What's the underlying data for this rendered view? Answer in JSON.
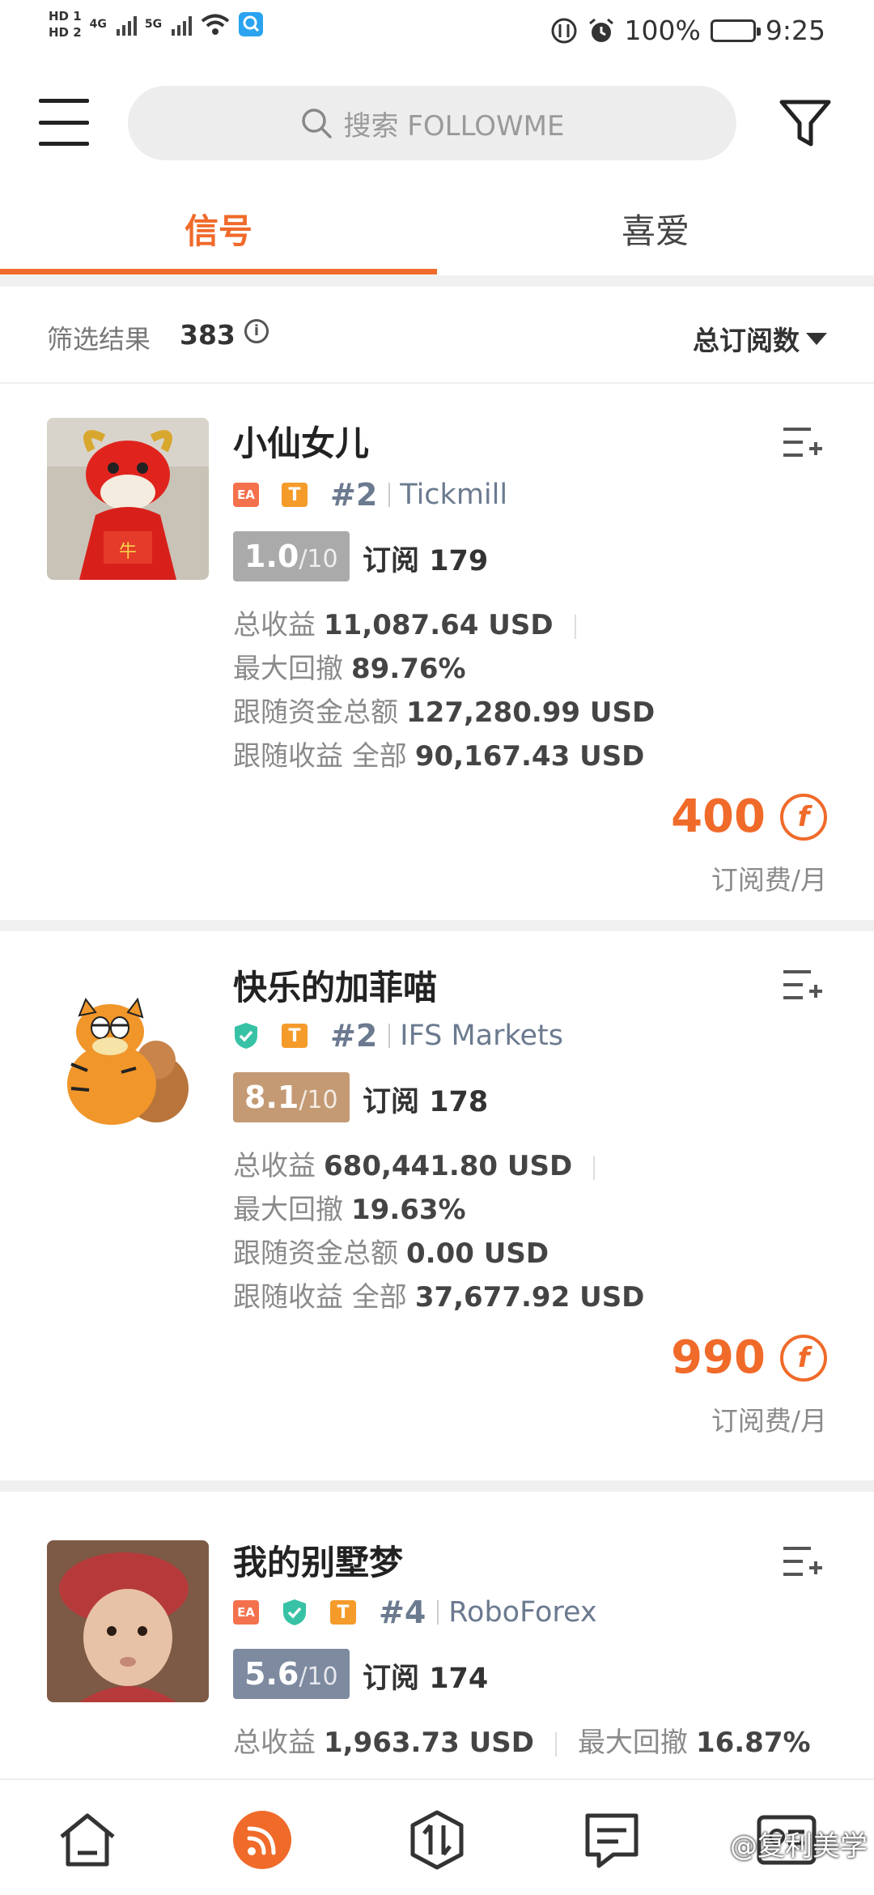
{
  "status_bar": {
    "hd1": "HD 1",
    "hd2": "HD 2",
    "net1": "4G",
    "net2": "5G",
    "battery": "100%",
    "time": "9:25"
  },
  "search": {
    "placeholder": "搜索 FOLLOWME"
  },
  "tabs": [
    {
      "label": "信号",
      "active": true
    },
    {
      "label": "喜爱",
      "active": false
    }
  ],
  "filter": {
    "label": "筛选结果",
    "count": "383",
    "sort_label": "总订阅数"
  },
  "signals": [
    {
      "name": "小仙女儿",
      "badges": [
        "EA",
        "T"
      ],
      "rank": "#2",
      "broker": "Tickmill",
      "score": "1.0",
      "score_max": "/10",
      "score_color": "#aaaaaa",
      "subs_label": "订阅",
      "subs_count": "179",
      "profit_label": "总收益",
      "profit": "11,087.64 USD",
      "drawdown_label": "最大回撤",
      "drawdown": "89.76%",
      "follow_funds_label": "跟随资金总额",
      "follow_funds": "127,280.99 USD",
      "follow_profit_label": "跟随收益 全部",
      "follow_profit": "90,167.43 USD",
      "price": "400",
      "price_unit": "订阅费/月",
      "coin_symbol": "f"
    },
    {
      "name": "快乐的加菲喵",
      "badges": [
        "shield",
        "T"
      ],
      "rank": "#2",
      "broker": "IFS Markets",
      "score": "8.1",
      "score_max": "/10",
      "score_color": "#c49a74",
      "subs_label": "订阅",
      "subs_count": "178",
      "profit_label": "总收益",
      "profit": "680,441.80 USD",
      "drawdown_label": "最大回撤",
      "drawdown": "19.63%",
      "follow_funds_label": "跟随资金总额",
      "follow_funds": "0.00 USD",
      "follow_profit_label": "跟随收益 全部",
      "follow_profit": "37,677.92 USD",
      "price": "990",
      "price_unit": "订阅费/月",
      "coin_symbol": "f"
    },
    {
      "name": "我的别墅梦",
      "badges": [
        "EA",
        "shield",
        "T"
      ],
      "rank": "#4",
      "broker": "RoboForex",
      "score": "5.6",
      "score_max": "/10",
      "score_color": "#7d8aa0",
      "subs_label": "订阅",
      "subs_count": "174",
      "profit_label": "总收益",
      "profit": "1,963.73 USD",
      "drawdown_label": "最大回撤",
      "drawdown": "16.87%"
    }
  ],
  "bottom_nav": {
    "items": [
      "home-icon",
      "feed-icon",
      "trade-icon",
      "message-icon",
      "profile-icon"
    ],
    "active": "feed-icon"
  },
  "watermark": "@复利美学",
  "colors": {
    "accent": "#f06a2a",
    "muted": "#8a8a8a"
  }
}
